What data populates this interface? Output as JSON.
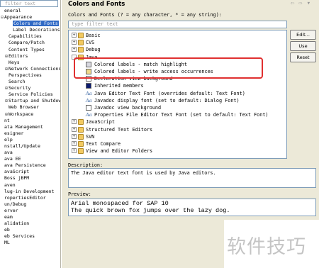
{
  "nav": {
    "filter_placeholder": "filter text",
    "items": [
      {
        "toggle": "",
        "label": "eneral"
      },
      {
        "toggle": "⊟",
        "label": "Appearance"
      },
      {
        "toggle": "",
        "label": "Colors and Fonts",
        "selected": true
      },
      {
        "toggle": "",
        "label": "Label Decorations"
      },
      {
        "toggle": "",
        "label": "Capabilities"
      },
      {
        "toggle": "",
        "label": "Compare/Patch"
      },
      {
        "toggle": "",
        "label": "Content Types"
      },
      {
        "toggle": "⊞",
        "label": "Editors"
      },
      {
        "toggle": "",
        "label": "Keys"
      },
      {
        "toggle": "⊞",
        "label": "Network Connections"
      },
      {
        "toggle": "",
        "label": "Perspectives"
      },
      {
        "toggle": "",
        "label": "Search"
      },
      {
        "toggle": "⊞",
        "label": "Security"
      },
      {
        "toggle": "",
        "label": "Service Policies"
      },
      {
        "toggle": "⊞",
        "label": "Startup and Shutdown"
      },
      {
        "toggle": "",
        "label": "Web Browser"
      },
      {
        "toggle": "⊞",
        "label": "Workspace"
      },
      {
        "toggle": "",
        "label": "nt"
      },
      {
        "toggle": "",
        "label": "ata Management"
      },
      {
        "toggle": "",
        "label": "esigner"
      },
      {
        "toggle": "",
        "label": "elp"
      },
      {
        "toggle": "",
        "label": "nstall/Update"
      },
      {
        "toggle": "",
        "label": "ava"
      },
      {
        "toggle": "",
        "label": "ava EE"
      },
      {
        "toggle": "",
        "label": "ava Persistence"
      },
      {
        "toggle": "",
        "label": "avaScript"
      },
      {
        "toggle": "",
        "label": "Boss jBPM"
      },
      {
        "toggle": "",
        "label": "aven"
      },
      {
        "toggle": "",
        "label": "lug-in Development"
      },
      {
        "toggle": "",
        "label": "ropertiesEditor"
      },
      {
        "toggle": "",
        "label": "un/Debug"
      },
      {
        "toggle": "",
        "label": "erver"
      },
      {
        "toggle": "",
        "label": "eam"
      },
      {
        "toggle": "",
        "label": "alidation"
      },
      {
        "toggle": "",
        "label": "eb"
      },
      {
        "toggle": "",
        "label": "eb Services"
      },
      {
        "toggle": "",
        "label": "ML"
      }
    ]
  },
  "page": {
    "title": "Colors and Fonts",
    "back_arrow": "⇦",
    "forward_arrow": "⇨",
    "menu_arrow": "▾",
    "description": "Colors and Fonts (? = any character, * = any string):",
    "filter_placeholder": "type filter text"
  },
  "tree": [
    {
      "toggle": "+",
      "icon": "folder",
      "label": "Basic"
    },
    {
      "toggle": "+",
      "icon": "folder",
      "label": "CVS"
    },
    {
      "toggle": "+",
      "icon": "folder",
      "label": "Debug"
    },
    {
      "toggle": "-",
      "icon": "folder",
      "label": "Java"
    },
    {
      "toggle": "",
      "icon": "swatch",
      "swatch_color": "#d8d8e0",
      "label": "Colored labels - match highlight"
    },
    {
      "toggle": "",
      "icon": "swatch",
      "swatch_color": "#f1d98a",
      "label": "Colored labels - write access occurrences"
    },
    {
      "toggle": "",
      "icon": "swatch",
      "swatch_color": "#ffffff",
      "label": "Declaration view background"
    },
    {
      "toggle": "",
      "icon": "swatch",
      "swatch_color": "#0b1a6e",
      "label": "Inherited members"
    },
    {
      "toggle": "",
      "icon": "font",
      "icon_text": "Aa",
      "label": "Java Editor Text Font (overrides default: Text Font)"
    },
    {
      "toggle": "",
      "icon": "font",
      "icon_text": "Aa",
      "label": "Javadoc display font (set to default: Dialog Font)"
    },
    {
      "toggle": "",
      "icon": "swatch",
      "swatch_color": "#ffffff",
      "label": "Javadoc view background"
    },
    {
      "toggle": "",
      "icon": "font",
      "icon_text": "Aa",
      "label": "Properties File Editor Text Font (set to default: Text Font)"
    },
    {
      "toggle": "+",
      "icon": "folder",
      "label": "JavaScript"
    },
    {
      "toggle": "+",
      "icon": "folder",
      "label": "Structured Text Editors"
    },
    {
      "toggle": "+",
      "icon": "folder",
      "label": "SVN"
    },
    {
      "toggle": "+",
      "icon": "folder",
      "label": "Text Compare"
    },
    {
      "toggle": "+",
      "icon": "folder",
      "label": "View and Editor Folders"
    }
  ],
  "buttons": {
    "edit": "Edit...",
    "use_system": "Use System",
    "reset": "Reset"
  },
  "description_section": {
    "label": "Description:",
    "text": "The Java editor text font is used by Java editors."
  },
  "preview_section": {
    "label": "Preview:",
    "line1": "Arial monospaced for SAP 10",
    "line2": "The quick brown fox jumps over the lazy dog."
  },
  "watermark": "软件技巧",
  "colors": {
    "selection": "#316ac5",
    "highlight_border": "#e03030",
    "panel_bg": "#ece9d8"
  }
}
